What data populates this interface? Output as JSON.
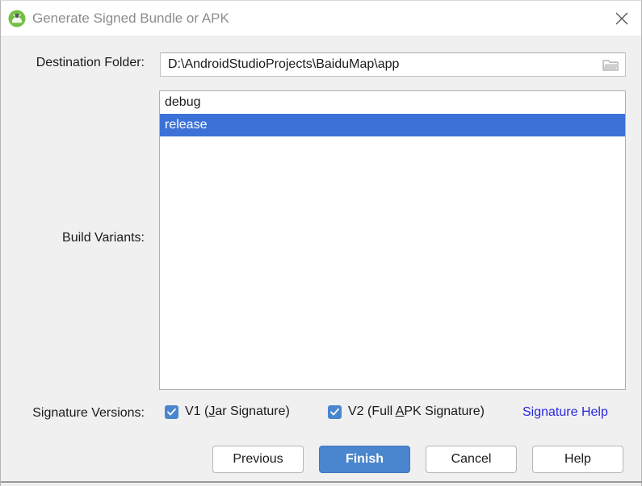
{
  "window": {
    "title": "Generate Signed Bundle or APK",
    "app_icon": "android-studio-icon",
    "close_icon": "close-icon"
  },
  "destination": {
    "label": "Destination Folder:",
    "value": "D:\\AndroidStudioProjects\\BaiduMap\\app",
    "placeholder": "",
    "browse_icon": "folder-icon"
  },
  "build_variants": {
    "label": "Build Variants:",
    "items": [
      {
        "name": "debug",
        "selected": false
      },
      {
        "name": "release",
        "selected": true
      }
    ]
  },
  "signature_versions": {
    "label": "Signature Versions:",
    "v1": {
      "text_before": "V1 (",
      "mnemonic": "J",
      "text_after": "ar Signature)",
      "checked": true,
      "full_label": "V1 (Jar Signature)"
    },
    "v2": {
      "text_before": "V2 (Full ",
      "mnemonic": "A",
      "text_after": "PK Signature)",
      "checked": true,
      "full_label": "V2 (Full APK Signature)"
    },
    "help_link": "Signature Help"
  },
  "footer": {
    "previous_label": "Previous",
    "finish_label": "Finish",
    "cancel_label": "Cancel",
    "help_label": "Help"
  },
  "colors": {
    "selection_blue": "#3c72d7",
    "accent_blue": "#4a86cd",
    "link_blue": "#2727dd",
    "dialog_background": "#f0f0f0",
    "title_text": "#8c8c8c"
  }
}
